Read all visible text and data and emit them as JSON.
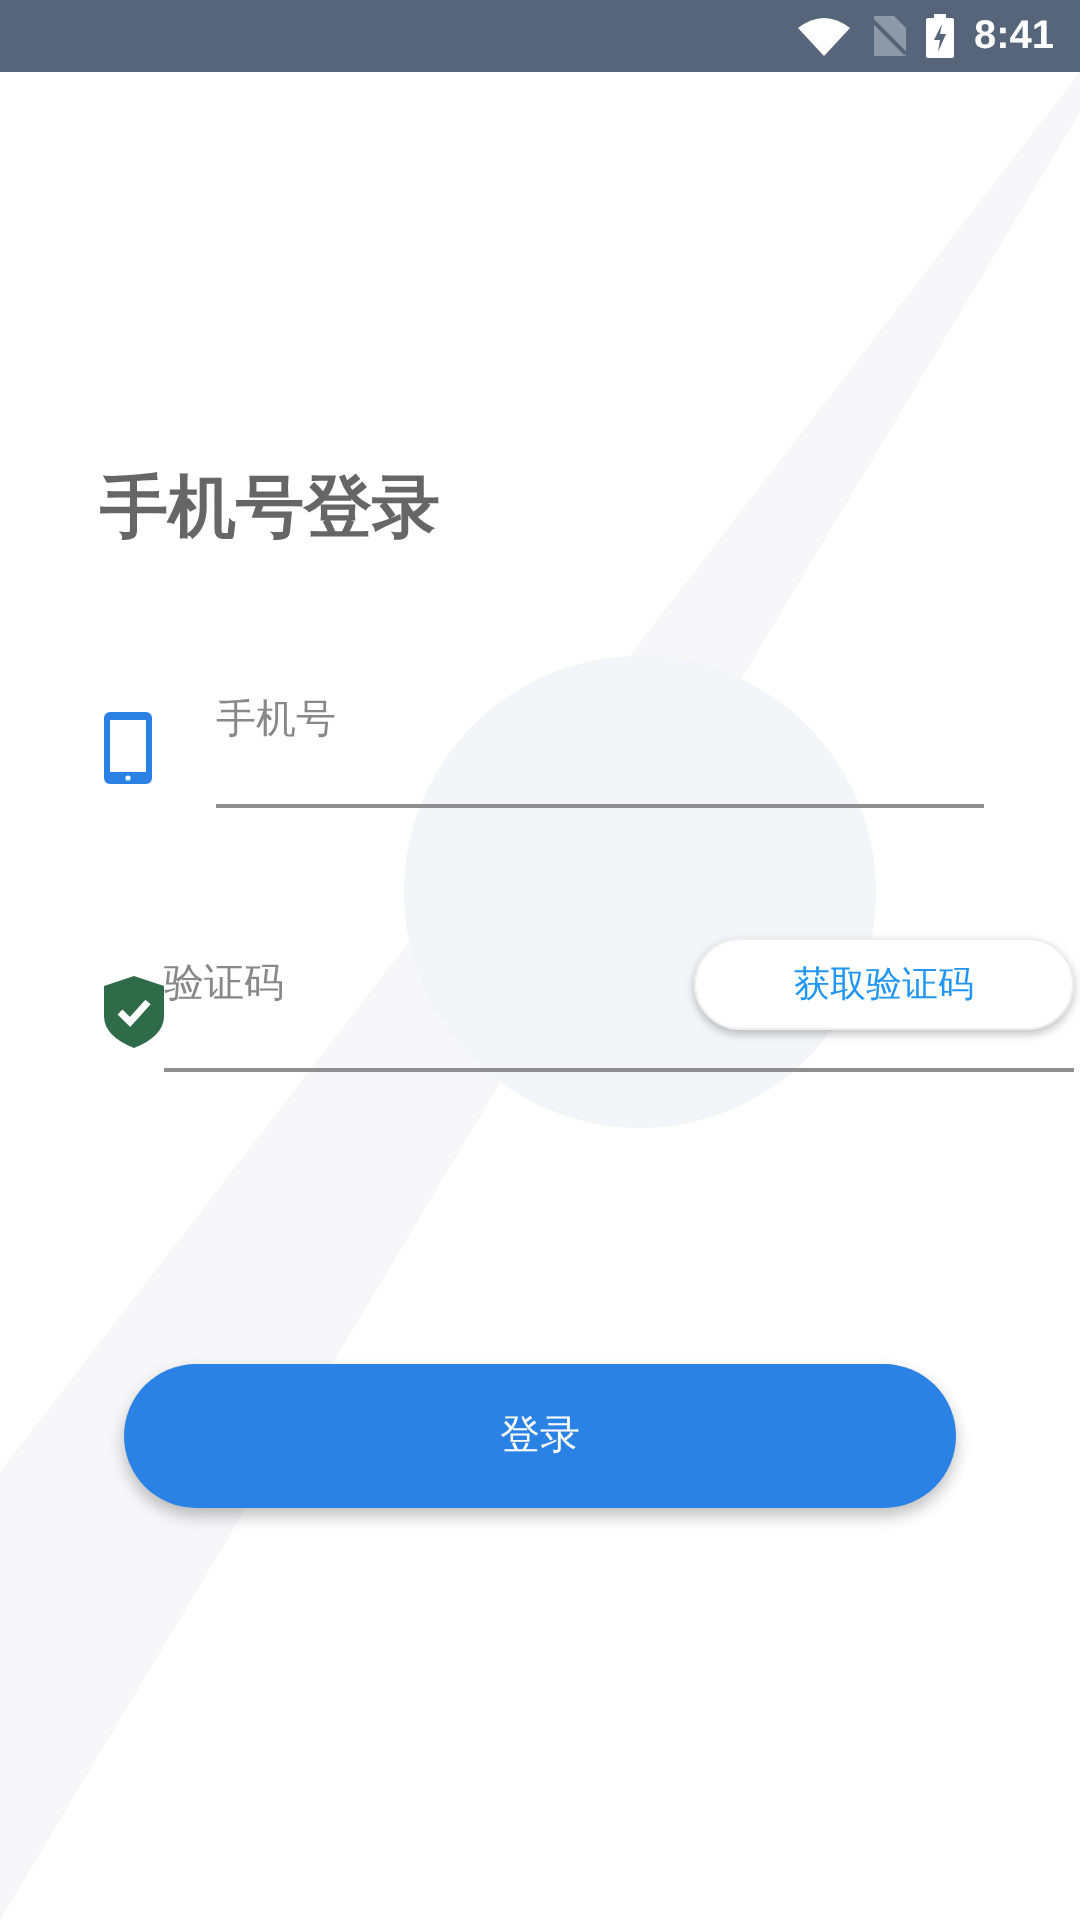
{
  "status_bar": {
    "time": "8:41"
  },
  "title": "手机号登录",
  "fields": [
    {
      "kind": "phone",
      "placeholder": "手机号"
    },
    {
      "kind": "code",
      "placeholder": "验证码",
      "button": "获取验证码"
    }
  ],
  "login_button": "登录"
}
